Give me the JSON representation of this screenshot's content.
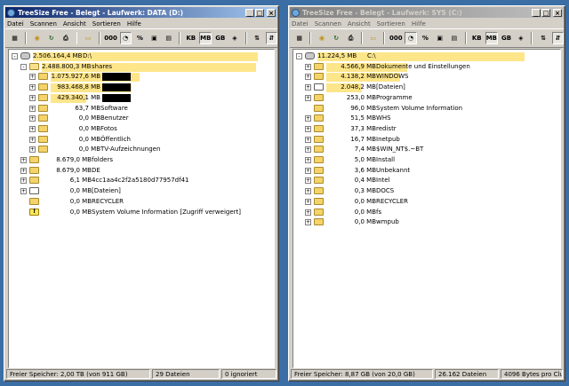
{
  "left": {
    "title": "TreeSize Free - Belegt - Laufwerk: DATA (D:)",
    "menu": [
      "Datei",
      "Scannen",
      "Ansicht",
      "Sortieren",
      "Hilfe"
    ],
    "toolbar": {
      "units": [
        "KB",
        "MB",
        "GB"
      ]
    },
    "rows": [
      {
        "size": "2.506.164,4 MB",
        "name": "D:\\",
        "indent": 0,
        "icon": "drive",
        "exp": "-",
        "bar": 100,
        "redacted": false
      },
      {
        "size": "2.488.800,3 MB",
        "name": "shares",
        "indent": 1,
        "icon": "open",
        "exp": "-",
        "bar": 99,
        "redacted": false
      },
      {
        "size": "1.075.927,6 MB",
        "name": "",
        "indent": 2,
        "icon": "folder",
        "exp": "+",
        "bar": 43,
        "redacted": true
      },
      {
        "size": "983.468,8 MB",
        "name": "",
        "indent": 2,
        "icon": "folder",
        "exp": "+",
        "bar": 39,
        "redacted": true
      },
      {
        "size": "429.340,1 MB",
        "name": "",
        "indent": 2,
        "icon": "folder",
        "exp": "+",
        "bar": 17,
        "redacted": true
      },
      {
        "size": "63,7 MB",
        "name": "Software",
        "indent": 2,
        "icon": "folder",
        "exp": "+",
        "bar": 0,
        "redacted": false
      },
      {
        "size": "0,0 MB",
        "name": "Benutzer",
        "indent": 2,
        "icon": "folder",
        "exp": "+",
        "bar": 0,
        "redacted": false
      },
      {
        "size": "0,0 MB",
        "name": "Fotos",
        "indent": 2,
        "icon": "folder",
        "exp": "+",
        "bar": 0,
        "redacted": false
      },
      {
        "size": "0,0 MB",
        "name": "Öffentlich",
        "indent": 2,
        "icon": "folder",
        "exp": "+",
        "bar": 0,
        "redacted": false
      },
      {
        "size": "0,0 MB",
        "name": "TV-Aufzeichnungen",
        "indent": 2,
        "icon": "folder",
        "exp": "+",
        "bar": 0,
        "redacted": false
      },
      {
        "size": "8.679,0 MB",
        "name": "folders",
        "indent": 1,
        "icon": "folder",
        "exp": "+",
        "bar": 0,
        "redacted": false
      },
      {
        "size": "8.679,0 MB",
        "name": "DE",
        "indent": 1,
        "icon": "folder",
        "exp": "+",
        "bar": 0,
        "redacted": false
      },
      {
        "size": "6,1 MB",
        "name": "4cc1aa4c2f2a5180d77957df41",
        "indent": 1,
        "icon": "folder",
        "exp": "+",
        "bar": 0,
        "redacted": false
      },
      {
        "size": "0,0 MB",
        "name": "[Dateien]",
        "indent": 1,
        "icon": "files",
        "exp": "+",
        "bar": 0,
        "redacted": false
      },
      {
        "size": "0,0 MB",
        "name": "RECYCLER",
        "indent": 1,
        "icon": "folder",
        "exp": "",
        "bar": 0,
        "redacted": false
      },
      {
        "size": "0,0 MB",
        "name": "System Volume Information  [Zugriff verweigert]",
        "indent": 1,
        "icon": "warn",
        "exp": "",
        "bar": 0,
        "redacted": false
      }
    ],
    "status": [
      "Freier Speicher: 2,00 TB   (von 911 GB)",
      "29  Dateien",
      "0 ignoriert"
    ]
  },
  "right": {
    "title": "TreeSize Free - Belegt - Laufwerk: SYS (C:)",
    "menu": [
      "Datei",
      "Scannen",
      "Ansicht",
      "Sortieren",
      "Hilfe"
    ],
    "toolbar": {
      "units": [
        "KB",
        "MB",
        "GB"
      ]
    },
    "rows": [
      {
        "size": "11.224,5 MB",
        "name": "C:\\",
        "indent": 0,
        "icon": "drive",
        "exp": "-",
        "bar": 100
      },
      {
        "size": "4.566,9 MB",
        "name": "Dokumente und Einstellungen",
        "indent": 1,
        "icon": "folder",
        "exp": "+",
        "bar": 41
      },
      {
        "size": "4.138,2 MB",
        "name": "WINDOWS",
        "indent": 1,
        "icon": "folder",
        "exp": "+",
        "bar": 37
      },
      {
        "size": "2.048,2 MB",
        "name": "[Dateien]",
        "indent": 1,
        "icon": "files",
        "exp": "+",
        "bar": 18
      },
      {
        "size": "253,0 MB",
        "name": "Programme",
        "indent": 1,
        "icon": "folder",
        "exp": "+",
        "bar": 0
      },
      {
        "size": "96,0 MB",
        "name": "System Volume Information",
        "indent": 1,
        "icon": "folder",
        "exp": "",
        "bar": 0
      },
      {
        "size": "51,5 MB",
        "name": "WHS",
        "indent": 1,
        "icon": "folder",
        "exp": "+",
        "bar": 0
      },
      {
        "size": "37,3 MB",
        "name": "redistr",
        "indent": 1,
        "icon": "folder",
        "exp": "+",
        "bar": 0
      },
      {
        "size": "16,7 MB",
        "name": "Inetpub",
        "indent": 1,
        "icon": "folder",
        "exp": "+",
        "bar": 0
      },
      {
        "size": "7,4 MB",
        "name": "$WIN_NT$.~BT",
        "indent": 1,
        "icon": "folder",
        "exp": "+",
        "bar": 0
      },
      {
        "size": "5,0 MB",
        "name": "Install",
        "indent": 1,
        "icon": "folder",
        "exp": "+",
        "bar": 0
      },
      {
        "size": "3,6 MB",
        "name": "Unbekannt",
        "indent": 1,
        "icon": "folder",
        "exp": "+",
        "bar": 0
      },
      {
        "size": "0,4 MB",
        "name": "Intel",
        "indent": 1,
        "icon": "folder",
        "exp": "+",
        "bar": 0
      },
      {
        "size": "0,3 MB",
        "name": "DOCS",
        "indent": 1,
        "icon": "folder",
        "exp": "+",
        "bar": 0
      },
      {
        "size": "0,0 MB",
        "name": "RECYCLER",
        "indent": 1,
        "icon": "folder",
        "exp": "+",
        "bar": 0
      },
      {
        "size": "0,0 MB",
        "name": "fs",
        "indent": 1,
        "icon": "folder",
        "exp": "+",
        "bar": 0
      },
      {
        "size": "0,0 MB",
        "name": "wmpub",
        "indent": 1,
        "icon": "folder",
        "exp": "+",
        "bar": 0
      }
    ],
    "status": [
      "Freier Speicher: 8,87 GB   (von 20,0 GB)",
      "26.162  Dateien",
      "4096 Bytes pro Cluster"
    ]
  }
}
